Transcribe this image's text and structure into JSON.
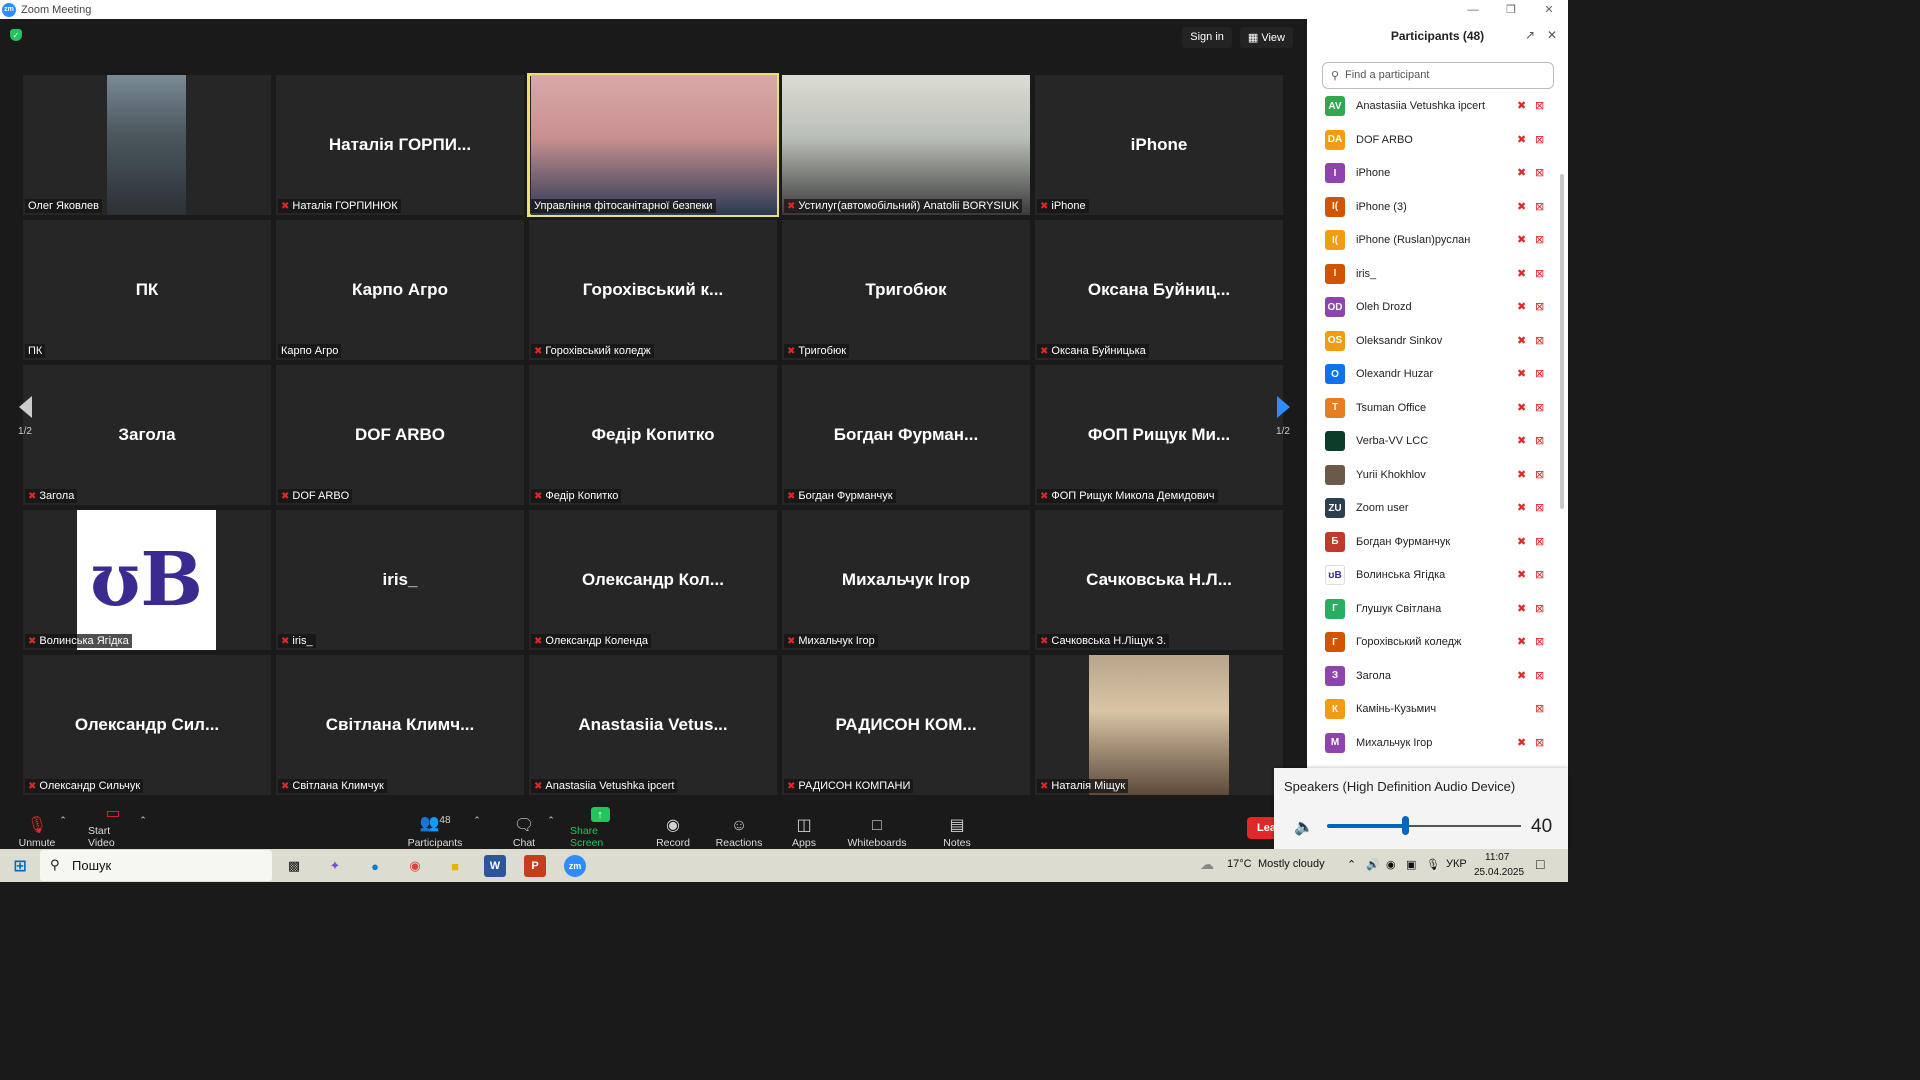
{
  "window": {
    "title": "Zoom Meeting",
    "app_icon": "zm"
  },
  "top_buttons": {
    "sign_in": "Sign in",
    "view": "View"
  },
  "tiles": [
    {
      "name": "Олег Яковлев",
      "big": "",
      "muted": false,
      "photo": true
    },
    {
      "name": "Наталія ГОРПИНЮК",
      "big": "Наталія ГОРПИ...",
      "muted": true,
      "photo": false
    },
    {
      "name": "Управління фітосанітарної безпеки",
      "big": "",
      "muted": false,
      "photo": true,
      "active": true
    },
    {
      "name": "Устилуг(автомобільний) Anatolii BORYSIUK",
      "big": "",
      "muted": true,
      "photo": true
    },
    {
      "name": "iPhone",
      "big": "iPhone",
      "muted": true,
      "photo": false
    },
    {
      "name": "ПК",
      "big": "ПК",
      "muted": false,
      "photo": false
    },
    {
      "name": "Карпо Агро",
      "big": "Карпо Агро",
      "muted": false,
      "photo": false
    },
    {
      "name": "Горохівський коледж",
      "big": "Горохівський к...",
      "muted": true,
      "photo": false
    },
    {
      "name": "Тригобюк",
      "big": "Тригобюк",
      "muted": true,
      "photo": false
    },
    {
      "name": "Оксана Буйницька",
      "big": "Оксана  Буйниц...",
      "muted": true,
      "photo": false
    },
    {
      "name": "Загола",
      "big": "Загола",
      "muted": true,
      "photo": false
    },
    {
      "name": "DOF ARBO",
      "big": "DOF ARBO",
      "muted": true,
      "photo": false
    },
    {
      "name": "Федір  Копитко",
      "big": "Федір  Копитко",
      "muted": true,
      "photo": false
    },
    {
      "name": "Богдан Фурманчук",
      "big": "Богдан  Фурман...",
      "muted": true,
      "photo": false
    },
    {
      "name": "ФОП Рищук Микола Демидович",
      "big": "ФОП Рищук Ми...",
      "muted": true,
      "photo": false
    },
    {
      "name": "Волинська Ягідка",
      "big": "",
      "muted": true,
      "photo": true,
      "logo": true
    },
    {
      "name": "iris_",
      "big": "iris_",
      "muted": true,
      "photo": false
    },
    {
      "name": "Олександр Коленда",
      "big": "Олександр  Кол...",
      "muted": true,
      "photo": false
    },
    {
      "name": "Михальчук Ігор",
      "big": "Михальчук Ігор",
      "muted": true,
      "photo": false
    },
    {
      "name": "Сачковська Н.Ліщук З.",
      "big": "Сачковська  Н.Л...",
      "muted": true,
      "photo": false
    },
    {
      "name": "Олександр Сильчук",
      "big": "Олександр  Сил...",
      "muted": true,
      "photo": false
    },
    {
      "name": "Світлана Климчук",
      "big": "Світлана  Климч...",
      "muted": true,
      "photo": false
    },
    {
      "name": "Anastasiia Vetushka ipcert",
      "big": "Anastasiia  Vetus...",
      "muted": true,
      "photo": false
    },
    {
      "name": "РАДИСОН КОМПАНИ",
      "big": "РАДИСОН  КОМ...",
      "muted": true,
      "photo": false
    },
    {
      "name": "Наталія Міщук",
      "big": "",
      "muted": true,
      "photo": true
    }
  ],
  "pager": {
    "left": "1/2",
    "right": "1/2"
  },
  "toolbar": {
    "unmute": "Unmute",
    "start_video": "Start Video",
    "participants": "Participants",
    "participants_count": "48",
    "chat": "Chat",
    "share_screen": "Share Screen",
    "record": "Record",
    "reactions": "Reactions",
    "apps": "Apps",
    "whiteboards": "Whiteboards",
    "notes": "Notes",
    "leave": "Lea"
  },
  "panel": {
    "title": "Participants (48)",
    "search_placeholder": "Find a participant",
    "participants": [
      {
        "initials": "AV",
        "color": "#2fa84f",
        "name": "Anastasiia Vetushka ipcert",
        "mic_muted": true,
        "cam_off": true
      },
      {
        "initials": "DA",
        "color": "#f39c12",
        "name": "DOF ARBO",
        "mic_muted": true,
        "cam_off": true
      },
      {
        "initials": "I",
        "color": "#8e44ad",
        "name": "iPhone",
        "mic_muted": true,
        "cam_off": true
      },
      {
        "initials": "I(",
        "color": "#d35400",
        "name": "iPhone (3)",
        "mic_muted": true,
        "cam_off": true
      },
      {
        "initials": "I(",
        "color": "#f39c12",
        "name": "iPhone (Ruslan)руслан",
        "mic_muted": true,
        "cam_off": true
      },
      {
        "initials": "I",
        "color": "#d35400",
        "name": "iris_",
        "mic_muted": true,
        "cam_off": true
      },
      {
        "initials": "OD",
        "color": "#8e44ad",
        "name": "Oleh Drozd",
        "mic_muted": true,
        "cam_off": true
      },
      {
        "initials": "OS",
        "color": "#f39c12",
        "name": "Oleksandr Sinkov",
        "mic_muted": true,
        "cam_off": true
      },
      {
        "initials": "O",
        "color": "#0e72ed",
        "name": "Olexandr Huzar",
        "mic_muted": true,
        "cam_off": true
      },
      {
        "initials": "T",
        "color": "#e67e22",
        "name": "Tsuman Office",
        "mic_muted": true,
        "cam_off": true
      },
      {
        "initials": "",
        "color": "#0b3d2a",
        "name": "Verba-VV LCC",
        "mic_muted": true,
        "cam_off": true,
        "image": true
      },
      {
        "initials": "",
        "color": "#6b5a4a",
        "name": "Yurii Khokhlov",
        "mic_muted": true,
        "cam_off": true,
        "image": true
      },
      {
        "initials": "ZU",
        "color": "#2c3e50",
        "name": "Zoom user",
        "mic_muted": true,
        "cam_off": true
      },
      {
        "initials": "Б",
        "color": "#c0392b",
        "name": "Богдан Фурманчук",
        "mic_muted": true,
        "cam_off": true
      },
      {
        "initials": "",
        "color": "#ffffff",
        "name": "Волинська Ягідка",
        "mic_muted": true,
        "cam_off": true,
        "image": true
      },
      {
        "initials": "Г",
        "color": "#27ae60",
        "name": "Глушук Світлана",
        "mic_muted": true,
        "cam_off": true
      },
      {
        "initials": "Г",
        "color": "#d35400",
        "name": "Горохівський коледж",
        "mic_muted": true,
        "cam_off": true
      },
      {
        "initials": "З",
        "color": "#8e44ad",
        "name": "Загола",
        "mic_muted": true,
        "cam_off": true
      },
      {
        "initials": "К",
        "color": "#f39c12",
        "name": "Камінь-Кузьмич",
        "mic_muted": false,
        "cam_off": true
      },
      {
        "initials": "М",
        "color": "#8e44ad",
        "name": "Михальчук Ігор",
        "mic_muted": true,
        "cam_off": true
      }
    ]
  },
  "audio_popup": {
    "device": "Speakers (High Definition Audio Device)",
    "volume": 40
  },
  "taskbar": {
    "search": "Пошук",
    "weather_temp": "17°C",
    "weather_text": "Mostly cloudy",
    "lang": "УКР",
    "time": "11:07",
    "date": "25.04.2025"
  }
}
